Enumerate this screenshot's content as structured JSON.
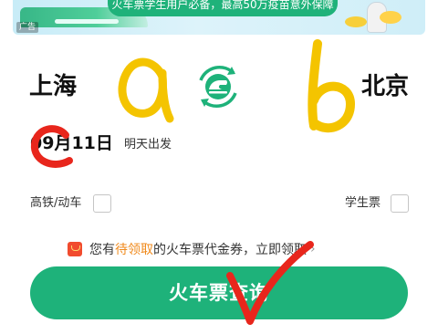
{
  "banner": {
    "text": "火车票学生用户必备，最高50万疫苗意外保障",
    "ad_tag": "广告"
  },
  "route": {
    "from_city": "上海",
    "to_city": "北京",
    "swap_icon": "train-swap-icon"
  },
  "date": {
    "value": "09月11日",
    "hint": "明天出发"
  },
  "options": {
    "high_speed_label": "高铁/动车",
    "high_speed_checked": false,
    "student_label": "学生票",
    "student_checked": false
  },
  "voucher": {
    "prefix": "您有",
    "highlight": "待领取",
    "middle": "的火车票代金券，",
    "suffix": "立即领取",
    "chevron": "›"
  },
  "query_button": {
    "label": "火车票查询"
  },
  "annotations": {
    "a": "a",
    "b": "b",
    "c": "c"
  },
  "colors": {
    "brand_green": "#1eb27a",
    "highlight_orange": "#f08a1c",
    "annotation_yellow": "#f4c400",
    "annotation_red": "#e8261c"
  }
}
